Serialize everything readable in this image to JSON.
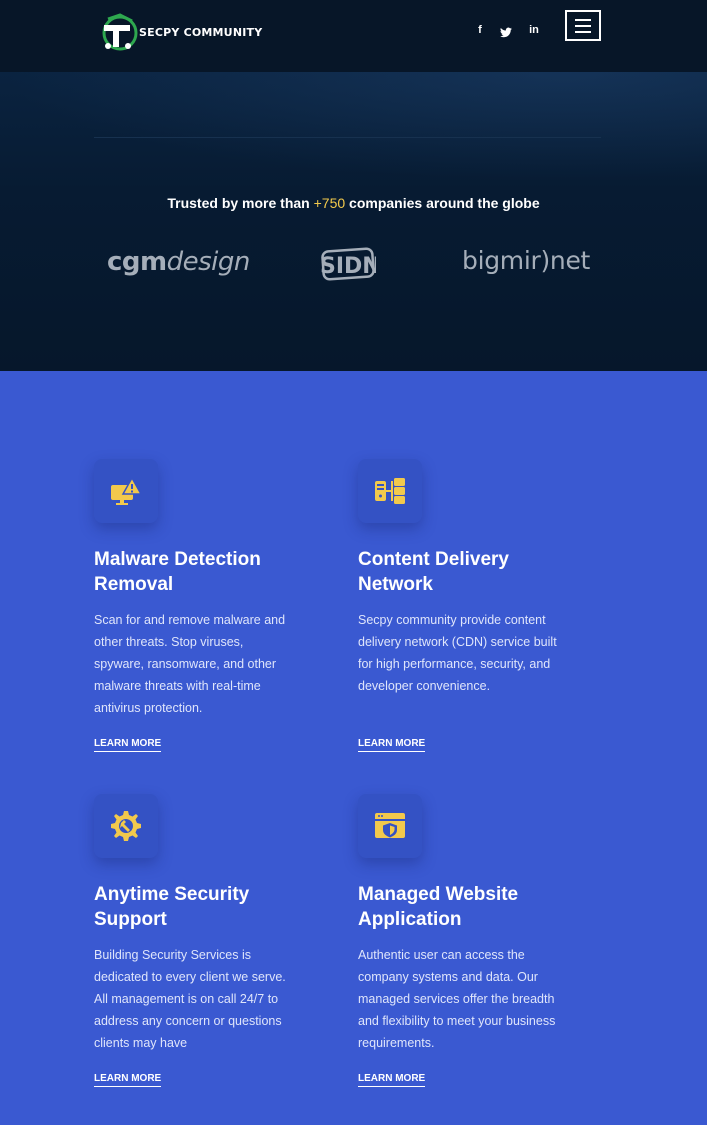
{
  "header": {
    "brand": "SECPY COMMUNITY",
    "social": [
      "f",
      "t",
      "in"
    ]
  },
  "hero": {
    "trusted_prefix": "Trusted by more than",
    "trusted_count": "+750",
    "trusted_suffix": "companies around the globe",
    "partners": [
      {
        "part1": "cgm",
        "part2": "design"
      },
      {
        "name": "SIDN"
      },
      {
        "name": "bigmir)net"
      }
    ]
  },
  "services": [
    {
      "title_line1": "Malware Detection",
      "title_line2": "Removal",
      "text": "Scan for and remove malware and other threats. Stop viruses, spyware, ransomware, and other malware threats with real-time antivirus protection.",
      "link": "LEARN MORE",
      "icon": "monitor-warning-icon"
    },
    {
      "title_line1": "Content Delivery",
      "title_line2": "Network",
      "text": "Secpy community provide content delivery network (CDN) service built for high performance, security, and developer convenience.",
      "link": "LEARN MORE",
      "icon": "server-network-icon"
    },
    {
      "title_line1": "Anytime Security",
      "title_line2": "Support",
      "text": "Building Security Services is dedicated to every client we serve. All management is on call 24/7 to address any concern or questions clients may have",
      "link": "LEARN MORE",
      "icon": "gear-wrench-icon"
    },
    {
      "title_line1": "Managed Website",
      "title_line2": "Application",
      "text": "Authentic user can access the company systems and data. Our managed services offer the breadth and flexibility to meet your business requirements.",
      "link": "LEARN MORE",
      "icon": "browser-shield-icon"
    }
  ],
  "colors": {
    "header_bg": "#071628",
    "section_bg": "#3a59d1",
    "accent": "#f2c94c",
    "partner_logo": "#a5aeb9"
  }
}
